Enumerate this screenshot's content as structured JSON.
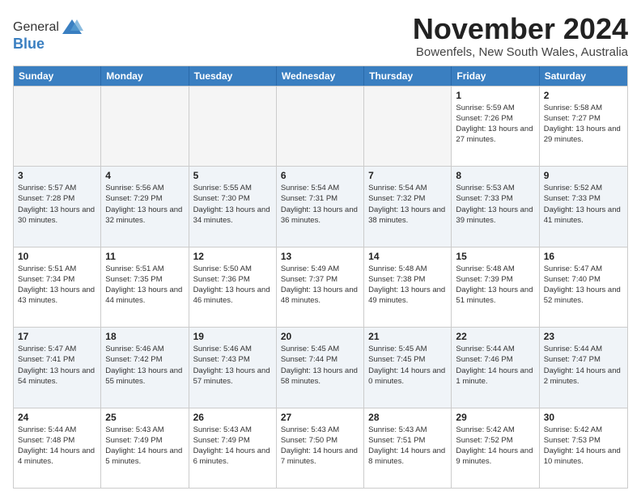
{
  "header": {
    "logo": {
      "general": "General",
      "blue": "Blue"
    },
    "title": "November 2024",
    "location": "Bowenfels, New South Wales, Australia"
  },
  "calendar": {
    "weekdays": [
      "Sunday",
      "Monday",
      "Tuesday",
      "Wednesday",
      "Thursday",
      "Friday",
      "Saturday"
    ],
    "weeks": [
      [
        {
          "day": "",
          "empty": true
        },
        {
          "day": "",
          "empty": true
        },
        {
          "day": "",
          "empty": true
        },
        {
          "day": "",
          "empty": true
        },
        {
          "day": "",
          "empty": true
        },
        {
          "day": "1",
          "sunrise": "Sunrise: 5:59 AM",
          "sunset": "Sunset: 7:26 PM",
          "daylight": "Daylight: 13 hours and 27 minutes."
        },
        {
          "day": "2",
          "sunrise": "Sunrise: 5:58 AM",
          "sunset": "Sunset: 7:27 PM",
          "daylight": "Daylight: 13 hours and 29 minutes."
        }
      ],
      [
        {
          "day": "3",
          "sunrise": "Sunrise: 5:57 AM",
          "sunset": "Sunset: 7:28 PM",
          "daylight": "Daylight: 13 hours and 30 minutes."
        },
        {
          "day": "4",
          "sunrise": "Sunrise: 5:56 AM",
          "sunset": "Sunset: 7:29 PM",
          "daylight": "Daylight: 13 hours and 32 minutes."
        },
        {
          "day": "5",
          "sunrise": "Sunrise: 5:55 AM",
          "sunset": "Sunset: 7:30 PM",
          "daylight": "Daylight: 13 hours and 34 minutes."
        },
        {
          "day": "6",
          "sunrise": "Sunrise: 5:54 AM",
          "sunset": "Sunset: 7:31 PM",
          "daylight": "Daylight: 13 hours and 36 minutes."
        },
        {
          "day": "7",
          "sunrise": "Sunrise: 5:54 AM",
          "sunset": "Sunset: 7:32 PM",
          "daylight": "Daylight: 13 hours and 38 minutes."
        },
        {
          "day": "8",
          "sunrise": "Sunrise: 5:53 AM",
          "sunset": "Sunset: 7:33 PM",
          "daylight": "Daylight: 13 hours and 39 minutes."
        },
        {
          "day": "9",
          "sunrise": "Sunrise: 5:52 AM",
          "sunset": "Sunset: 7:33 PM",
          "daylight": "Daylight: 13 hours and 41 minutes."
        }
      ],
      [
        {
          "day": "10",
          "sunrise": "Sunrise: 5:51 AM",
          "sunset": "Sunset: 7:34 PM",
          "daylight": "Daylight: 13 hours and 43 minutes."
        },
        {
          "day": "11",
          "sunrise": "Sunrise: 5:51 AM",
          "sunset": "Sunset: 7:35 PM",
          "daylight": "Daylight: 13 hours and 44 minutes."
        },
        {
          "day": "12",
          "sunrise": "Sunrise: 5:50 AM",
          "sunset": "Sunset: 7:36 PM",
          "daylight": "Daylight: 13 hours and 46 minutes."
        },
        {
          "day": "13",
          "sunrise": "Sunrise: 5:49 AM",
          "sunset": "Sunset: 7:37 PM",
          "daylight": "Daylight: 13 hours and 48 minutes."
        },
        {
          "day": "14",
          "sunrise": "Sunrise: 5:48 AM",
          "sunset": "Sunset: 7:38 PM",
          "daylight": "Daylight: 13 hours and 49 minutes."
        },
        {
          "day": "15",
          "sunrise": "Sunrise: 5:48 AM",
          "sunset": "Sunset: 7:39 PM",
          "daylight": "Daylight: 13 hours and 51 minutes."
        },
        {
          "day": "16",
          "sunrise": "Sunrise: 5:47 AM",
          "sunset": "Sunset: 7:40 PM",
          "daylight": "Daylight: 13 hours and 52 minutes."
        }
      ],
      [
        {
          "day": "17",
          "sunrise": "Sunrise: 5:47 AM",
          "sunset": "Sunset: 7:41 PM",
          "daylight": "Daylight: 13 hours and 54 minutes."
        },
        {
          "day": "18",
          "sunrise": "Sunrise: 5:46 AM",
          "sunset": "Sunset: 7:42 PM",
          "daylight": "Daylight: 13 hours and 55 minutes."
        },
        {
          "day": "19",
          "sunrise": "Sunrise: 5:46 AM",
          "sunset": "Sunset: 7:43 PM",
          "daylight": "Daylight: 13 hours and 57 minutes."
        },
        {
          "day": "20",
          "sunrise": "Sunrise: 5:45 AM",
          "sunset": "Sunset: 7:44 PM",
          "daylight": "Daylight: 13 hours and 58 minutes."
        },
        {
          "day": "21",
          "sunrise": "Sunrise: 5:45 AM",
          "sunset": "Sunset: 7:45 PM",
          "daylight": "Daylight: 14 hours and 0 minutes."
        },
        {
          "day": "22",
          "sunrise": "Sunrise: 5:44 AM",
          "sunset": "Sunset: 7:46 PM",
          "daylight": "Daylight: 14 hours and 1 minute."
        },
        {
          "day": "23",
          "sunrise": "Sunrise: 5:44 AM",
          "sunset": "Sunset: 7:47 PM",
          "daylight": "Daylight: 14 hours and 2 minutes."
        }
      ],
      [
        {
          "day": "24",
          "sunrise": "Sunrise: 5:44 AM",
          "sunset": "Sunset: 7:48 PM",
          "daylight": "Daylight: 14 hours and 4 minutes."
        },
        {
          "day": "25",
          "sunrise": "Sunrise: 5:43 AM",
          "sunset": "Sunset: 7:49 PM",
          "daylight": "Daylight: 14 hours and 5 minutes."
        },
        {
          "day": "26",
          "sunrise": "Sunrise: 5:43 AM",
          "sunset": "Sunset: 7:49 PM",
          "daylight": "Daylight: 14 hours and 6 minutes."
        },
        {
          "day": "27",
          "sunrise": "Sunrise: 5:43 AM",
          "sunset": "Sunset: 7:50 PM",
          "daylight": "Daylight: 14 hours and 7 minutes."
        },
        {
          "day": "28",
          "sunrise": "Sunrise: 5:43 AM",
          "sunset": "Sunset: 7:51 PM",
          "daylight": "Daylight: 14 hours and 8 minutes."
        },
        {
          "day": "29",
          "sunrise": "Sunrise: 5:42 AM",
          "sunset": "Sunset: 7:52 PM",
          "daylight": "Daylight: 14 hours and 9 minutes."
        },
        {
          "day": "30",
          "sunrise": "Sunrise: 5:42 AM",
          "sunset": "Sunset: 7:53 PM",
          "daylight": "Daylight: 14 hours and 10 minutes."
        }
      ]
    ]
  }
}
